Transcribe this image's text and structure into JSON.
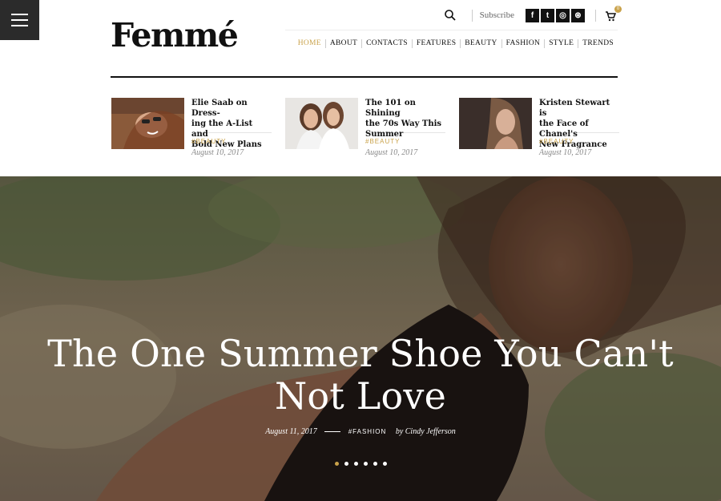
{
  "brand": {
    "logo": "Femmé"
  },
  "topbar": {
    "subscribe": "Subscribe",
    "social": [
      {
        "icon": "facebook-icon",
        "glyph": "f"
      },
      {
        "icon": "twitter-icon",
        "glyph": "t"
      },
      {
        "icon": "instagram-icon",
        "glyph": "◎"
      },
      {
        "icon": "dribbble-icon",
        "glyph": "⊛"
      }
    ],
    "cart_count": "0"
  },
  "nav": {
    "items": [
      "HOME",
      "ABOUT",
      "CONTACTS",
      "FEATURES",
      "BEAUTY",
      "FASHION",
      "STYLE",
      "TRENDS"
    ],
    "active_index": 0
  },
  "featured_posts": [
    {
      "title_lines": [
        "Elie Saab on Dress-",
        "ing the A-List and",
        "Bold New Plans"
      ],
      "tag": "#BEAUTY",
      "date": "August 10, 2017"
    },
    {
      "title_lines": [
        "The 101 on Shining",
        "the 70s Way This",
        "Summer"
      ],
      "tag": "#BEAUTY",
      "date": "August 10, 2017"
    },
    {
      "title_lines": [
        "Kristen Stewart is",
        "the Face of Chanel's",
        "New Fragrance"
      ],
      "tag": "#BEAUTY",
      "date": "August 10, 2017"
    }
  ],
  "hero": {
    "title_lines": [
      "The One Summer Shoe You Can't",
      "Not Love"
    ],
    "date": "August 11, 2017",
    "category": "#FASHION",
    "author": "by Cindy Jefferson",
    "slides": 6,
    "active_slide": 0
  },
  "colors": {
    "accent": "#c9a24a",
    "dark": "#2b2b2b"
  }
}
